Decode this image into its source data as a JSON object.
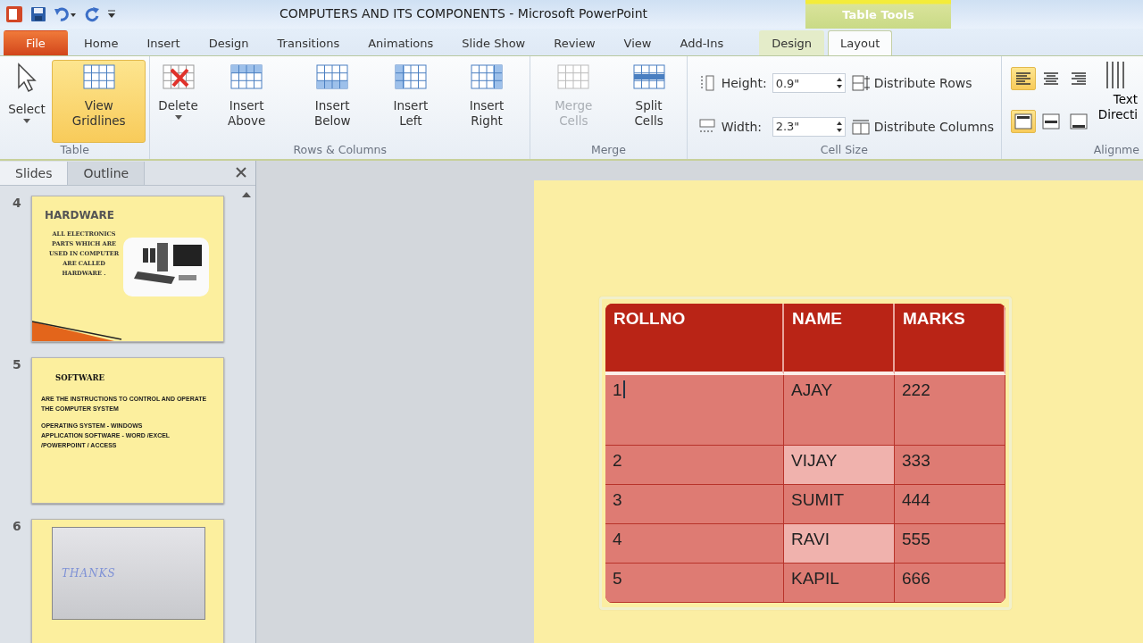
{
  "window": {
    "title": "COMPUTERS AND ITS COMPONENTS  -  Microsoft PowerPoint",
    "context_tab_group": "Table Tools"
  },
  "ribbon_tabs": [
    {
      "label": "File",
      "kind": "file",
      "selected": false
    },
    {
      "label": "Home",
      "kind": "normal",
      "selected": false
    },
    {
      "label": "Insert",
      "kind": "normal",
      "selected": false
    },
    {
      "label": "Design",
      "kind": "normal",
      "selected": false
    },
    {
      "label": "Transitions",
      "kind": "normal",
      "selected": false
    },
    {
      "label": "Animations",
      "kind": "normal",
      "selected": false
    },
    {
      "label": "Slide Show",
      "kind": "normal",
      "selected": false
    },
    {
      "label": "Review",
      "kind": "normal",
      "selected": false
    },
    {
      "label": "View",
      "kind": "normal",
      "selected": false
    },
    {
      "label": "Add-Ins",
      "kind": "normal",
      "selected": false
    },
    {
      "label": "Design",
      "kind": "context",
      "selected": false
    },
    {
      "label": "Layout",
      "kind": "context",
      "selected": true
    }
  ],
  "ribbon_groups": [
    {
      "label": "Table",
      "buttons": [
        {
          "label": "Select",
          "kind": "cursor",
          "dropdown": true,
          "selected": false,
          "disabled": false
        },
        {
          "label": "View Gridlines",
          "kind": "grid",
          "dropdown": false,
          "selected": true,
          "disabled": false
        }
      ]
    },
    {
      "label": "Rows & Columns",
      "buttons": [
        {
          "label": "Delete",
          "kind": "delete",
          "dropdown": true,
          "selected": false,
          "disabled": false
        },
        {
          "label": "Insert Above",
          "kind": "above",
          "dropdown": false,
          "selected": false,
          "disabled": false
        },
        {
          "label": "Insert Below",
          "kind": "below",
          "dropdown": false,
          "selected": false,
          "disabled": false
        },
        {
          "label": "Insert Left",
          "kind": "left",
          "dropdown": false,
          "selected": false,
          "disabled": false
        },
        {
          "label": "Insert Right",
          "kind": "right",
          "dropdown": false,
          "selected": false,
          "disabled": false
        }
      ]
    },
    {
      "label": "Merge",
      "buttons": [
        {
          "label": "Merge Cells",
          "kind": "merge",
          "dropdown": false,
          "selected": false,
          "disabled": true
        },
        {
          "label": "Split Cells",
          "kind": "split",
          "dropdown": false,
          "selected": false,
          "disabled": false
        }
      ]
    }
  ],
  "cell_size": {
    "label": "Cell Size",
    "height_label": "Height:",
    "height_value": "0.9\"",
    "width_label": "Width:",
    "width_value": "2.3\"",
    "distribute_rows": "Distribute Rows",
    "distribute_columns": "Distribute Columns"
  },
  "alignment": {
    "label": "Alignme",
    "text_direction": "Text Directi",
    "buttons": [
      {
        "kind": "left",
        "selected": true
      },
      {
        "kind": "center",
        "selected": false
      },
      {
        "kind": "right",
        "selected": false
      },
      {
        "kind": "top",
        "selected": true
      },
      {
        "kind": "middle",
        "selected": false
      },
      {
        "kind": "bottom",
        "selected": false
      }
    ]
  },
  "panel_tabs": [
    {
      "label": "Slides",
      "selected": true
    },
    {
      "label": "Outline",
      "selected": false
    }
  ],
  "slides": [
    {
      "number": "4",
      "kind": "hardware",
      "title": "HARDWARE",
      "lines": [
        "ALL ELECTRONICS",
        "PARTS WHICH ARE",
        "USED IN COMPUTER",
        "ARE CALLED",
        "HARDWARE ."
      ]
    },
    {
      "number": "5",
      "kind": "software",
      "title": "SOFTWARE",
      "lines": [
        "ARE THE INSTRUCTIONS TO CONTROL AND OPERATE",
        "THE COMPUTER SYSTEM",
        "OPERATING SYSTEM - WINDOWS",
        "APPLICATION SOFTWARE - WORD /EXCEL",
        "/POWERPOINT / ACCESS"
      ]
    },
    {
      "number": "6",
      "kind": "thanks",
      "title": "THANKS"
    }
  ],
  "table": {
    "columns": [
      "ROLLNO",
      "NAME",
      "MARKS"
    ],
    "rows": [
      [
        {
          "text": "1",
          "highlighted": false,
          "cursor": true
        },
        {
          "text": "AJAY",
          "highlighted": false,
          "cursor": false
        },
        {
          "text": "222",
          "highlighted": false,
          "cursor": false
        }
      ],
      [
        {
          "text": "2",
          "highlighted": false,
          "cursor": false
        },
        {
          "text": "VIJAY",
          "highlighted": true,
          "cursor": false
        },
        {
          "text": "333",
          "highlighted": false,
          "cursor": false
        }
      ],
      [
        {
          "text": "3",
          "highlighted": false,
          "cursor": false
        },
        {
          "text": "SUMIT",
          "highlighted": false,
          "cursor": false
        },
        {
          "text": "444",
          "highlighted": false,
          "cursor": false
        }
      ],
      [
        {
          "text": "4",
          "highlighted": false,
          "cursor": false
        },
        {
          "text": "RAVI",
          "highlighted": true,
          "cursor": false
        },
        {
          "text": "555",
          "highlighted": false,
          "cursor": false
        }
      ],
      [
        {
          "text": "5",
          "highlighted": false,
          "cursor": false
        },
        {
          "text": "KAPIL",
          "highlighted": false,
          "cursor": false
        },
        {
          "text": "666",
          "highlighted": false,
          "cursor": false
        }
      ]
    ]
  }
}
